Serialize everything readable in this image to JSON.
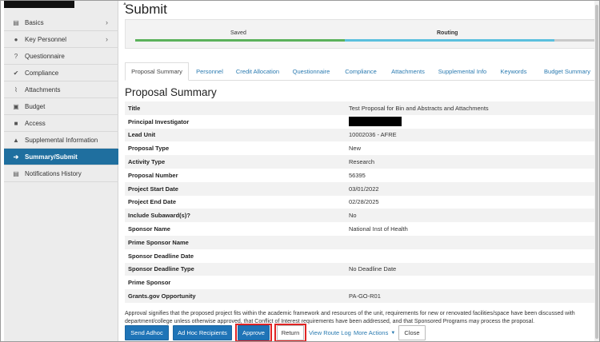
{
  "page": {
    "title": "Submit"
  },
  "sidebar": {
    "items": [
      {
        "label": "Basics",
        "icon": "list-icon",
        "has_chevron": true
      },
      {
        "label": "Key Personnel",
        "icon": "user-icon",
        "has_chevron": true
      },
      {
        "label": "Questionnaire",
        "icon": "question-icon"
      },
      {
        "label": "Compliance",
        "icon": "check-icon"
      },
      {
        "label": "Attachments",
        "icon": "paperclip-icon"
      },
      {
        "label": "Budget",
        "icon": "money-icon"
      },
      {
        "label": "Access",
        "icon": "lock-icon"
      },
      {
        "label": "Supplemental Information",
        "icon": "bell-icon"
      },
      {
        "label": "Summary/Submit",
        "icon": "arrow-right-icon",
        "active": true
      },
      {
        "label": "Notifications History",
        "icon": "list-icon"
      }
    ]
  },
  "progress": {
    "saved": "Saved",
    "routing": "Routing"
  },
  "tabs": [
    "Proposal Summary",
    "Personnel",
    "Credit Allocation",
    "Questionnaire",
    "Compliance",
    "Attachments",
    "Supplemental Info",
    "Keywords",
    "Budget Summary"
  ],
  "summary": {
    "title": "Proposal Summary",
    "rows": [
      {
        "label": "Title",
        "value": "Test Proposal for Bin and Abstracts and Attachments"
      },
      {
        "label": "Principal Investigator",
        "value": ""
      },
      {
        "label": "Lead Unit",
        "value": "10002036 - AFRE"
      },
      {
        "label": "Proposal Type",
        "value": "New"
      },
      {
        "label": "Activity Type",
        "value": "Research"
      },
      {
        "label": "Proposal Number",
        "value": "56395"
      },
      {
        "label": "Project Start Date",
        "value": "03/01/2022"
      },
      {
        "label": "Project End Date",
        "value": "02/28/2025"
      },
      {
        "label": "Include Subaward(s)?",
        "value": "No"
      },
      {
        "label": "Sponsor Name",
        "value": "National Inst of Health"
      },
      {
        "label": "Prime Sponsor Name",
        "value": ""
      },
      {
        "label": "Sponsor Deadline Date",
        "value": ""
      },
      {
        "label": "Sponsor Deadline Type",
        "value": "No Deadline Date"
      },
      {
        "label": "Prime Sponsor",
        "value": ""
      },
      {
        "label": "Grants.gov Opportunity",
        "value": "PA-GO-R01"
      }
    ]
  },
  "approval": {
    "line1": "Approval signifies that the proposed project fits within the academic framework and resources of the unit, requirements for new or renovated facilities/space have been discussed with",
    "line2": "department/college unless otherwise approved, that Conflict of Interest requirements have been addressed, and that Sponsored Programs may process the proposal."
  },
  "actions": {
    "send_adhoc": "Send Adhoc",
    "adhoc_recipients": "Ad Hoc Recipients",
    "approve": "Approve",
    "return": "Return",
    "view_route_log": "View Route Log",
    "more_actions": "More Actions",
    "close": "Close"
  },
  "colors": {
    "accent": "#1f74b7",
    "active_nav": "#1f6f9f",
    "saved_bar": "#5bb25b",
    "routing_bar": "#5bc0de",
    "highlight": "#e02424"
  }
}
